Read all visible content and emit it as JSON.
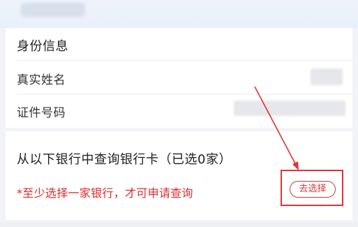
{
  "identity_section": {
    "title": "身份信息",
    "real_name_label": "真实姓名",
    "id_number_label": "证件号码"
  },
  "bank_section": {
    "title": "从以下银行中查询银行卡（已选0家）",
    "warning": "*至少选择一家银行，才可申请查询",
    "choose_button_label": "去选择"
  },
  "colors": {
    "warning_red": "#e02a2a",
    "annotation_red": "#e23232"
  }
}
